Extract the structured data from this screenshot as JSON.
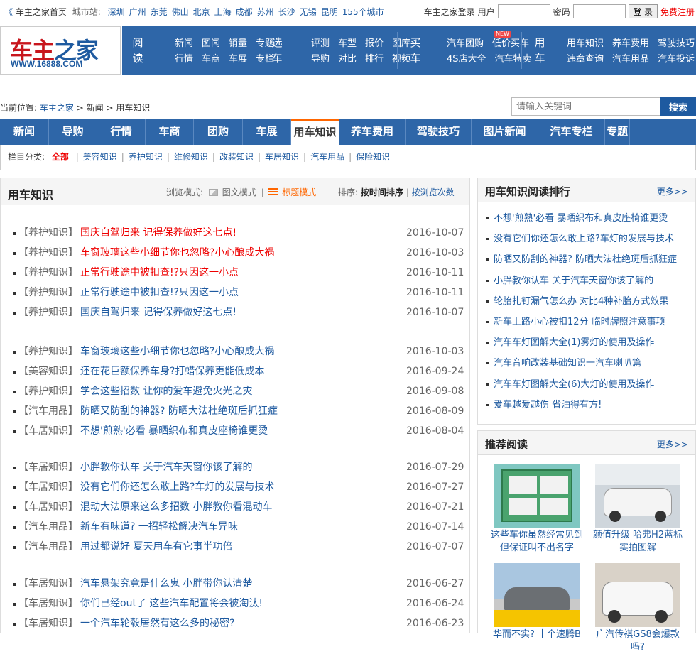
{
  "topbar": {
    "home": "车主之家首页",
    "city_label": "城市站:",
    "cities": [
      "深圳",
      "广州",
      "东莞",
      "佛山",
      "北京",
      "上海",
      "成都",
      "苏州",
      "长沙",
      "无锡",
      "昆明",
      "155个城市"
    ],
    "login_label": "车主之家登录",
    "user_label": "用户",
    "pass_label": "密码",
    "login_button": "登 录",
    "register": "免费注册"
  },
  "logo": {
    "text_main": "车主",
    "text_accent": "之家",
    "url": "WWW.16888.COM"
  },
  "nav_groups": [
    {
      "cat": [
        "阅",
        "读"
      ],
      "row1": [
        "新闻",
        "图闻",
        "销量",
        "专题"
      ],
      "row2": [
        "行情",
        "车商",
        "车展",
        "专栏"
      ]
    },
    {
      "cat": [
        "选",
        "车"
      ],
      "row1": [
        "评测",
        "车型",
        "报价",
        "图库"
      ],
      "row2": [
        "导购",
        "对比",
        "排行",
        "视频"
      ]
    },
    {
      "cat": [
        "买",
        "车"
      ],
      "row1": [
        "汽车团购",
        "低价买车"
      ],
      "row2": [
        "4S店大全",
        "汽车特卖"
      ]
    },
    {
      "cat": [
        "用",
        "车"
      ],
      "row1": [
        "用车知识",
        "养车费用",
        "驾驶技巧"
      ],
      "row2": [
        "违章查询",
        "汽车用品",
        "汽车投诉"
      ]
    }
  ],
  "new_badge": "NEW",
  "breadcrumb": {
    "prefix": "当前位置:",
    "items": [
      "车主之家",
      "新闻",
      "用车知识"
    ],
    "sep": ">"
  },
  "search": {
    "placeholder": "请输入关键词",
    "button": "搜索"
  },
  "main_nav": [
    "新闻",
    "导购",
    "行情",
    "车商",
    "团购",
    "车展",
    "用车知识",
    "养车费用",
    "驾驶技巧",
    "图片新闻",
    "汽车专栏",
    "专题汇总"
  ],
  "main_nav_active": 6,
  "subcategories": {
    "label": "栏目分类:",
    "active": "全部",
    "items": [
      "美容知识",
      "养护知识",
      "维修知识",
      "改装知识",
      "车居知识",
      "汽车用品",
      "保险知识"
    ]
  },
  "list_header": {
    "title": "用车知识",
    "mode_label": "浏览模式:",
    "mode_pic": "图文模式",
    "mode_title": "标题模式",
    "sort_label": "排序:",
    "sort_time": "按时间排序",
    "sort_views": "按浏览次数"
  },
  "articles": [
    [
      {
        "tag": "【养护知识】",
        "title": "国庆自驾归来 记得保养做好这七点!",
        "date": "2016-10-07",
        "hot": true
      },
      {
        "tag": "【养护知识】",
        "title": "车窗玻璃这些小细节你也忽略?小心酿成大祸",
        "date": "2016-10-03",
        "hot": true
      },
      {
        "tag": "【养护知识】",
        "title": "正常行驶途中被扣查!?只因这一小点",
        "date": "2016-10-11",
        "hot": true
      },
      {
        "tag": "【养护知识】",
        "title": "正常行驶途中被扣查!?只因这一小点",
        "date": "2016-10-11",
        "hot": false
      },
      {
        "tag": "【养护知识】",
        "title": "国庆自驾归来 记得保养做好这七点!",
        "date": "2016-10-07",
        "hot": false
      }
    ],
    [
      {
        "tag": "【养护知识】",
        "title": "车窗玻璃这些小细节你也忽略?小心酿成大祸",
        "date": "2016-10-03",
        "hot": false
      },
      {
        "tag": "【美容知识】",
        "title": "还在花巨额保养车身?打蜡保养更能低成本",
        "date": "2016-09-24",
        "hot": false
      },
      {
        "tag": "【养护知识】",
        "title": "学会这些招数 让你的爱车避免火光之灾",
        "date": "2016-09-08",
        "hot": false
      },
      {
        "tag": "【汽车用品】",
        "title": "防晒又防刮的神器? 防晒大法杜绝斑后抓狂症",
        "date": "2016-08-09",
        "hot": false
      },
      {
        "tag": "【车居知识】",
        "title": "不想'煎熟'必看 暴晒织布和真皮座椅谁更烫",
        "date": "2016-08-04",
        "hot": false
      }
    ],
    [
      {
        "tag": "【车居知识】",
        "title": "小胖教你认车 关于汽车天窗你该了解的",
        "date": "2016-07-29",
        "hot": false
      },
      {
        "tag": "【车居知识】",
        "title": "没有它们你还怎么敢上路?车灯的发展与技术",
        "date": "2016-07-27",
        "hot": false
      },
      {
        "tag": "【车居知识】",
        "title": "混动大法原来这么多招数 小胖教你看混动车",
        "date": "2016-07-21",
        "hot": false
      },
      {
        "tag": "【汽车用品】",
        "title": "新车有味道? 一招轻松解决汽车异味",
        "date": "2016-07-14",
        "hot": false
      },
      {
        "tag": "【汽车用品】",
        "title": "用过都说好 夏天用车有它事半功倍",
        "date": "2016-07-07",
        "hot": false
      }
    ],
    [
      {
        "tag": "【车居知识】",
        "title": "汽车悬架究竟是什么鬼 小胖带你认清楚",
        "date": "2016-06-27",
        "hot": false
      },
      {
        "tag": "【车居知识】",
        "title": "你们已经out了 这些汽车配置将会被淘汰!",
        "date": "2016-06-24",
        "hot": false
      },
      {
        "tag": "【车居知识】",
        "title": "一个汽车轮毂居然有这么多的秘密?",
        "date": "2016-06-23",
        "hot": false
      }
    ]
  ],
  "ranking": {
    "title": "用车知识阅读排行",
    "more": "更多>>",
    "items": [
      "不想'煎熟'必看 暴晒织布和真皮座椅谁更烫",
      "没有它们你还怎么敢上路?车灯的发展与技术",
      "防晒又防刮的神器? 防晒大法杜绝斑后抓狂症",
      "小胖教你认车 关于汽车天窗你该了解的",
      "轮胎扎钉漏气怎么办 对比4种补胎方式效果",
      "新车上路小心被扣12分 临时牌照注意事项",
      "汽车车灯图解大全(1)雾灯的使用及操作",
      "汽车音响改装基础知识一汽车喇叭篇",
      "汽车车灯图解大全(6)大灯的使用及操作",
      "爱车越爱越伤 省油得有方!"
    ]
  },
  "recommend": {
    "title": "推荐阅读",
    "more": "更多>>",
    "cards": [
      {
        "caption": "这些车你虽然经常见到但保证叫不出名字"
      },
      {
        "caption": "颜值升级 哈弗H2蓝标实拍图解"
      },
      {
        "caption": "华而不实? 十个速腾B"
      },
      {
        "caption": "广汽传祺GS8会爆款吗?"
      }
    ]
  },
  "colors": {
    "nav_blue": "#2e66a8",
    "link_blue": "#1e5aa0",
    "hot_red": "#e00",
    "accent_orange": "#f60"
  }
}
